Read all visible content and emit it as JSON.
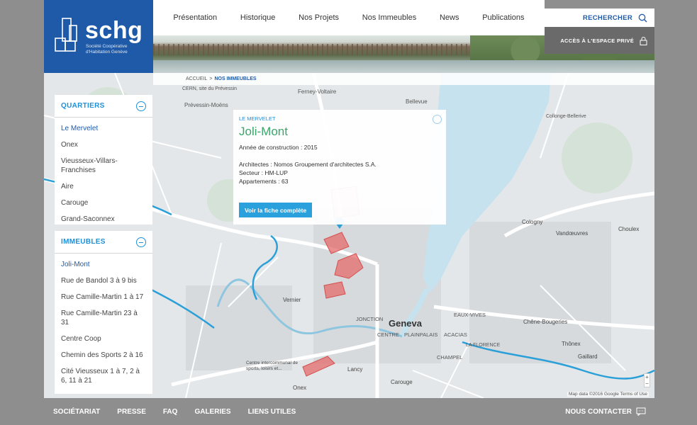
{
  "brand": {
    "name": "schg",
    "subtitle": "Société Coopérative d'Habitation Genève",
    "color": "#1e5aa8"
  },
  "nav": {
    "items": [
      "Présentation",
      "Historique",
      "Nos Projets",
      "Nos Immeubles",
      "News",
      "Publications"
    ]
  },
  "search": {
    "label": "RECHERCHER",
    "icon": "search-icon"
  },
  "private_access": {
    "label": "ACCÈS À L'ESPACE PRIVÉ",
    "icon": "lock-icon"
  },
  "breadcrumb": {
    "home": "ACCUEIL",
    "separator": ">",
    "current": "NOS IMMEUBLES"
  },
  "quartiers": {
    "title": "QUARTIERS",
    "items": [
      "Le Mervelet",
      "Onex",
      "Vieusseux-Villars-Franchises",
      "Aire",
      "Carouge",
      "Grand-Saconnex"
    ],
    "active_index": 0
  },
  "immeubles": {
    "title": "IMMEUBLES",
    "items": [
      "Joli-Mont",
      "Rue de Bandol 3 à 9 bis",
      "Rue Camille-Martin 1 à 17",
      "Rue Camille-Martin 23 à 31",
      "Centre Coop",
      "Chemin des Sports 2 à 16",
      "Cité Vieusseux 1 à 7, 2 à 6, 11 à 21"
    ],
    "active_index": 0
  },
  "card": {
    "category": "LE MERVELET",
    "title": "Joli-Mont",
    "year": "Année de construction : 2015",
    "architects": "Architectes : Nomos Groupement d'architectes S.A.",
    "sector": "Secteur : HM-LUP",
    "apartments": "Appartements : 63",
    "button": "Voir la fiche complète",
    "title_color": "#3aa66a"
  },
  "map": {
    "labels": [
      "Ferney-Voltaire",
      "Bellevue",
      "CERN, site du Prévessin",
      "Prévessin-Moëns",
      "Collonge-Bellerive",
      "Cologny",
      "Vandœuvres",
      "Choulex",
      "Vernier",
      "Geneva",
      "Chêne-Bougeries",
      "Thônex",
      "Gaillard",
      "Lancy",
      "Carouge",
      "Onex",
      "JONCTION",
      "CENTRE",
      "PLAINPALAIS",
      "ACACIAS",
      "EAUX-VIVES",
      "CHAMPEL",
      "LA FLORENCE",
      "Centre intercommunal de sports, loisirs et..."
    ],
    "zoom_in": "+",
    "zoom_out": "−",
    "attribution": "Map data ©2016 Google   Terms of Use",
    "lake_color": "#c6e2ef",
    "marker_color": "#2b9fd8"
  },
  "footer": {
    "links": [
      "SOCIÉTARIAT",
      "PRESSE",
      "FAQ",
      "GALERIES",
      "LIENS UTILES"
    ],
    "contact": "NOUS CONTACTER",
    "contact_icon": "chat-icon"
  }
}
